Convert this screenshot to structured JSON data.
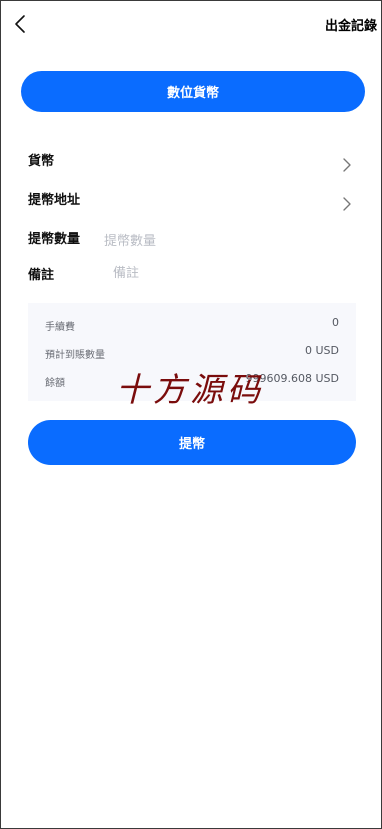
{
  "header": {
    "back_icon": "chevron-left-icon",
    "history_label": "出金記錄"
  },
  "currency_button": {
    "label": "數位貨幣"
  },
  "form": {
    "currency_label": "貨幣",
    "address_label": "提幣地址",
    "amount_label": "提幣數量",
    "amount_placeholder": "提幣數量",
    "amount_value": "",
    "note_label": "備註",
    "note_placeholder": "備註",
    "note_value": "",
    "chevron_icon": "chevron-right-icon"
  },
  "summary": {
    "fee_label": "手續費",
    "fee_value": "0",
    "expected_label": "預計到賬數量",
    "expected_value": "0 USD",
    "balance_label": "餘額",
    "balance_value": "999609.608 USD"
  },
  "watermark": {
    "text": "十方源码"
  },
  "submit": {
    "label": "提幣"
  },
  "colors": {
    "accent": "#0a6cff",
    "summary_bg": "#f7f8fc",
    "watermark": "#7a0c0c"
  }
}
